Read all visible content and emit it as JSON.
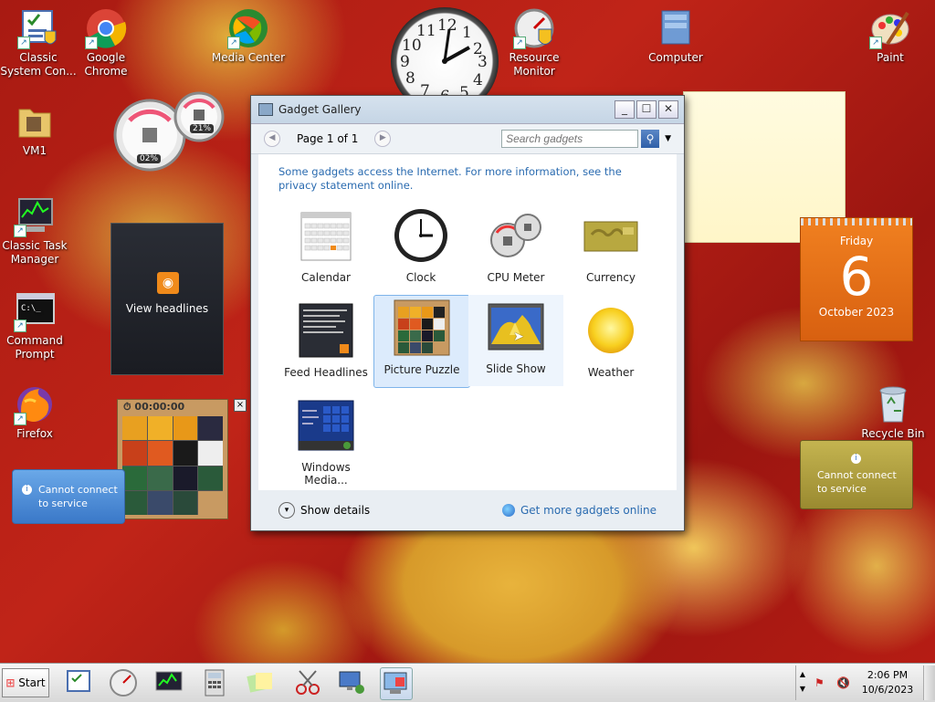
{
  "desktop": {
    "icons": [
      {
        "label": "Classic System Con...",
        "icon": "control-panel-icon"
      },
      {
        "label": "Google Chrome",
        "icon": "chrome-icon"
      },
      {
        "label": "Media Center",
        "icon": "media-center-icon"
      },
      {
        "label": "Resource Monitor",
        "icon": "resource-monitor-icon"
      },
      {
        "label": "Computer",
        "icon": "computer-icon"
      },
      {
        "label": "Paint",
        "icon": "paint-icon"
      },
      {
        "label": "VM1",
        "icon": "folder-icon"
      },
      {
        "label": "Classic Task Manager",
        "icon": "task-manager-icon"
      },
      {
        "label": "Command Prompt",
        "icon": "command-prompt-icon"
      },
      {
        "label": "Firefox",
        "icon": "firefox-icon"
      },
      {
        "label": "Recycle Bin",
        "icon": "recycle-bin-icon"
      }
    ]
  },
  "gadgets_on_desktop": {
    "cpu_meter": {
      "cpu": "02%",
      "memory": "21%"
    },
    "feed": {
      "label": "View headlines"
    },
    "puzzle": {
      "timer": "00:00:00"
    },
    "weather_error": {
      "text": "Cannot connect to service"
    },
    "currency_error": {
      "text": "Cannot connect to service"
    },
    "calendar": {
      "weekday": "Friday",
      "day": "6",
      "month_year": "October 2023"
    },
    "clock_numbers": [
      "12",
      "1",
      "2",
      "3",
      "4",
      "5",
      "6",
      "7",
      "8",
      "9",
      "10",
      "11"
    ]
  },
  "window": {
    "title": "Gadget Gallery",
    "page_label": "Page 1 of 1",
    "search_placeholder": "Search gadgets",
    "notice": "Some gadgets access the Internet.  For more information, see the privacy statement online.",
    "gadgets": [
      {
        "label": "Calendar",
        "icon": "calendar-icon"
      },
      {
        "label": "Clock",
        "icon": "clock-icon"
      },
      {
        "label": "CPU Meter",
        "icon": "cpu-meter-icon"
      },
      {
        "label": "Currency",
        "icon": "currency-icon"
      },
      {
        "label": "Feed Headlines",
        "icon": "feed-headlines-icon"
      },
      {
        "label": "Picture Puzzle",
        "icon": "picture-puzzle-icon"
      },
      {
        "label": "Slide Show",
        "icon": "slide-show-icon"
      },
      {
        "label": "Weather",
        "icon": "weather-icon"
      },
      {
        "label": "Windows Media...",
        "icon": "windows-media-icon"
      }
    ],
    "show_details": "Show details",
    "get_more": "Get more gadgets online"
  },
  "taskbar": {
    "start_label": "Start",
    "time": "2:06 PM",
    "date": "10/6/2023"
  },
  "colors": {
    "accent": "#2a6bb0",
    "selected_bg": "#dcebfc",
    "calendar_orange": "#e06a10"
  }
}
